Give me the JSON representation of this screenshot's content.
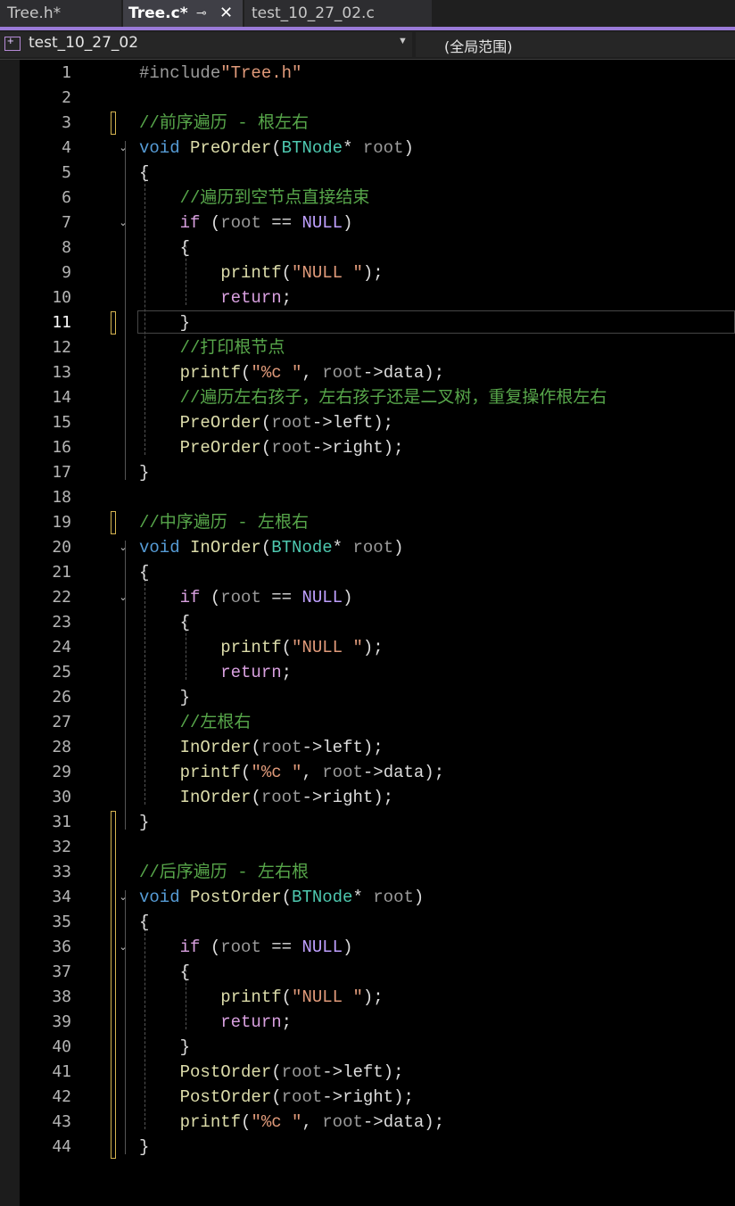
{
  "tabs": [
    {
      "label": "Tree.h*",
      "active": false
    },
    {
      "label": "Tree.c*",
      "active": true
    },
    {
      "label": "test_10_27_02.c",
      "active": false
    }
  ],
  "tab_pin_icon": "pin-icon",
  "tab_close_icon": "close-icon",
  "navbar": {
    "project": "test_10_27_02",
    "scope": "(全局范围)"
  },
  "colors": {
    "accent": "#9a7ad8",
    "change_marker": "#d4b350",
    "comment": "#57a64a",
    "keyword": "#569cd6",
    "function": "#dcdcaa",
    "type": "#4ec9b0",
    "string": "#e09a7a",
    "macro": "#bfa0ff"
  },
  "current_line": 11,
  "lines": [
    {
      "n": "1",
      "t": [
        [
          "pp",
          "#include"
        ],
        [
          "str",
          "\"Tree.h\""
        ]
      ]
    },
    {
      "n": "2",
      "t": []
    },
    {
      "n": "3",
      "t": [
        [
          "cmt",
          "//前序遍历 - 根左右"
        ]
      ]
    },
    {
      "n": "4",
      "t": [
        [
          "kw",
          "void"
        ],
        [
          "punc",
          " "
        ],
        [
          "fn",
          "PreOrder"
        ],
        [
          "punc",
          "("
        ],
        [
          "type",
          "BTNode"
        ],
        [
          "punc",
          "* "
        ],
        [
          "param",
          "root"
        ],
        [
          "punc",
          ")"
        ]
      ]
    },
    {
      "n": "5",
      "t": [
        [
          "punc",
          "{"
        ]
      ]
    },
    {
      "n": "6",
      "t": [
        [
          "punc",
          "    "
        ],
        [
          "cmt",
          "//遍历到空节点直接结束"
        ]
      ]
    },
    {
      "n": "7",
      "t": [
        [
          "punc",
          "    "
        ],
        [
          "ctrl",
          "if"
        ],
        [
          "punc",
          " ("
        ],
        [
          "param",
          "root"
        ],
        [
          "punc",
          " == "
        ],
        [
          "macro",
          "NULL"
        ],
        [
          "punc",
          ")"
        ]
      ]
    },
    {
      "n": "8",
      "t": [
        [
          "punc",
          "    {"
        ]
      ]
    },
    {
      "n": "9",
      "t": [
        [
          "punc",
          "        "
        ],
        [
          "fn",
          "printf"
        ],
        [
          "punc",
          "("
        ],
        [
          "str",
          "\"NULL \""
        ],
        [
          "punc",
          ");"
        ]
      ]
    },
    {
      "n": "10",
      "t": [
        [
          "punc",
          "        "
        ],
        [
          "ctrl",
          "return"
        ],
        [
          "punc",
          ";"
        ]
      ]
    },
    {
      "n": "11",
      "t": [
        [
          "punc",
          "    }"
        ]
      ]
    },
    {
      "n": "12",
      "t": [
        [
          "punc",
          "    "
        ],
        [
          "cmt",
          "//打印根节点"
        ]
      ]
    },
    {
      "n": "13",
      "t": [
        [
          "punc",
          "    "
        ],
        [
          "fn",
          "printf"
        ],
        [
          "punc",
          "("
        ],
        [
          "str",
          "\"%c \""
        ],
        [
          "punc",
          ", "
        ],
        [
          "param",
          "root"
        ],
        [
          "punc",
          "->"
        ],
        [
          "field",
          "data"
        ],
        [
          "punc",
          ");"
        ]
      ]
    },
    {
      "n": "14",
      "t": [
        [
          "punc",
          "    "
        ],
        [
          "cmt",
          "//遍历左右孩子，左右孩子还是二叉树，重复操作根左右"
        ]
      ]
    },
    {
      "n": "15",
      "t": [
        [
          "punc",
          "    "
        ],
        [
          "fn",
          "PreOrder"
        ],
        [
          "punc",
          "("
        ],
        [
          "param",
          "root"
        ],
        [
          "punc",
          "->"
        ],
        [
          "field",
          "left"
        ],
        [
          "punc",
          ");"
        ]
      ]
    },
    {
      "n": "16",
      "t": [
        [
          "punc",
          "    "
        ],
        [
          "fn",
          "PreOrder"
        ],
        [
          "punc",
          "("
        ],
        [
          "param",
          "root"
        ],
        [
          "punc",
          "->"
        ],
        [
          "field",
          "right"
        ],
        [
          "punc",
          ");"
        ]
      ]
    },
    {
      "n": "17",
      "t": [
        [
          "punc",
          "}"
        ]
      ]
    },
    {
      "n": "18",
      "t": []
    },
    {
      "n": "19",
      "t": [
        [
          "cmt",
          "//中序遍历 - 左根右"
        ]
      ]
    },
    {
      "n": "20",
      "t": [
        [
          "kw",
          "void"
        ],
        [
          "punc",
          " "
        ],
        [
          "fn",
          "InOrder"
        ],
        [
          "punc",
          "("
        ],
        [
          "type",
          "BTNode"
        ],
        [
          "punc",
          "* "
        ],
        [
          "param",
          "root"
        ],
        [
          "punc",
          ")"
        ]
      ]
    },
    {
      "n": "21",
      "t": [
        [
          "punc",
          "{"
        ]
      ]
    },
    {
      "n": "22",
      "t": [
        [
          "punc",
          "    "
        ],
        [
          "ctrl",
          "if"
        ],
        [
          "punc",
          " ("
        ],
        [
          "param",
          "root"
        ],
        [
          "punc",
          " == "
        ],
        [
          "macro",
          "NULL"
        ],
        [
          "punc",
          ")"
        ]
      ]
    },
    {
      "n": "23",
      "t": [
        [
          "punc",
          "    {"
        ]
      ]
    },
    {
      "n": "24",
      "t": [
        [
          "punc",
          "        "
        ],
        [
          "fn",
          "printf"
        ],
        [
          "punc",
          "("
        ],
        [
          "str",
          "\"NULL \""
        ],
        [
          "punc",
          ");"
        ]
      ]
    },
    {
      "n": "25",
      "t": [
        [
          "punc",
          "        "
        ],
        [
          "ctrl",
          "return"
        ],
        [
          "punc",
          ";"
        ]
      ]
    },
    {
      "n": "26",
      "t": [
        [
          "punc",
          "    }"
        ]
      ]
    },
    {
      "n": "27",
      "t": [
        [
          "punc",
          "    "
        ],
        [
          "cmt",
          "//左根右"
        ]
      ]
    },
    {
      "n": "28",
      "t": [
        [
          "punc",
          "    "
        ],
        [
          "fn",
          "InOrder"
        ],
        [
          "punc",
          "("
        ],
        [
          "param",
          "root"
        ],
        [
          "punc",
          "->"
        ],
        [
          "field",
          "left"
        ],
        [
          "punc",
          ");"
        ]
      ]
    },
    {
      "n": "29",
      "t": [
        [
          "punc",
          "    "
        ],
        [
          "fn",
          "printf"
        ],
        [
          "punc",
          "("
        ],
        [
          "str",
          "\"%c \""
        ],
        [
          "punc",
          ", "
        ],
        [
          "param",
          "root"
        ],
        [
          "punc",
          "->"
        ],
        [
          "field",
          "data"
        ],
        [
          "punc",
          ");"
        ]
      ]
    },
    {
      "n": "30",
      "t": [
        [
          "punc",
          "    "
        ],
        [
          "fn",
          "InOrder"
        ],
        [
          "punc",
          "("
        ],
        [
          "param",
          "root"
        ],
        [
          "punc",
          "->"
        ],
        [
          "field",
          "right"
        ],
        [
          "punc",
          ");"
        ]
      ]
    },
    {
      "n": "31",
      "t": [
        [
          "punc",
          "}"
        ]
      ]
    },
    {
      "n": "32",
      "t": []
    },
    {
      "n": "33",
      "t": [
        [
          "cmt",
          "//后序遍历 - 左右根"
        ]
      ]
    },
    {
      "n": "34",
      "t": [
        [
          "kw",
          "void"
        ],
        [
          "punc",
          " "
        ],
        [
          "fn",
          "PostOrder"
        ],
        [
          "punc",
          "("
        ],
        [
          "type",
          "BTNode"
        ],
        [
          "punc",
          "* "
        ],
        [
          "param",
          "root"
        ],
        [
          "punc",
          ")"
        ]
      ]
    },
    {
      "n": "35",
      "t": [
        [
          "punc",
          "{"
        ]
      ]
    },
    {
      "n": "36",
      "t": [
        [
          "punc",
          "    "
        ],
        [
          "ctrl",
          "if"
        ],
        [
          "punc",
          " ("
        ],
        [
          "param",
          "root"
        ],
        [
          "punc",
          " == "
        ],
        [
          "macro",
          "NULL"
        ],
        [
          "punc",
          ")"
        ]
      ]
    },
    {
      "n": "37",
      "t": [
        [
          "punc",
          "    {"
        ]
      ]
    },
    {
      "n": "38",
      "t": [
        [
          "punc",
          "        "
        ],
        [
          "fn",
          "printf"
        ],
        [
          "punc",
          "("
        ],
        [
          "str",
          "\"NULL \""
        ],
        [
          "punc",
          ");"
        ]
      ]
    },
    {
      "n": "39",
      "t": [
        [
          "punc",
          "        "
        ],
        [
          "ctrl",
          "return"
        ],
        [
          "punc",
          ";"
        ]
      ]
    },
    {
      "n": "40",
      "t": [
        [
          "punc",
          "    }"
        ]
      ]
    },
    {
      "n": "41",
      "t": [
        [
          "punc",
          "    "
        ],
        [
          "fn",
          "PostOrder"
        ],
        [
          "punc",
          "("
        ],
        [
          "param",
          "root"
        ],
        [
          "punc",
          "->"
        ],
        [
          "field",
          "left"
        ],
        [
          "punc",
          ");"
        ]
      ]
    },
    {
      "n": "42",
      "t": [
        [
          "punc",
          "    "
        ],
        [
          "fn",
          "PostOrder"
        ],
        [
          "punc",
          "("
        ],
        [
          "param",
          "root"
        ],
        [
          "punc",
          "->"
        ],
        [
          "field",
          "right"
        ],
        [
          "punc",
          ");"
        ]
      ]
    },
    {
      "n": "43",
      "t": [
        [
          "punc",
          "    "
        ],
        [
          "fn",
          "printf"
        ],
        [
          "punc",
          "("
        ],
        [
          "str",
          "\"%c \""
        ],
        [
          "punc",
          ", "
        ],
        [
          "param",
          "root"
        ],
        [
          "punc",
          "->"
        ],
        [
          "field",
          "data"
        ],
        [
          "punc",
          ");"
        ]
      ]
    },
    {
      "n": "44",
      "t": [
        [
          "punc",
          "}"
        ]
      ]
    }
  ],
  "fold_lines": [
    "4",
    "7",
    "20",
    "22",
    "34",
    "36"
  ],
  "changed_lines": [
    "3",
    "11",
    "19",
    "31",
    "32",
    "33",
    "34",
    "35",
    "36",
    "37",
    "38",
    "39",
    "40",
    "41",
    "42",
    "43",
    "44"
  ]
}
